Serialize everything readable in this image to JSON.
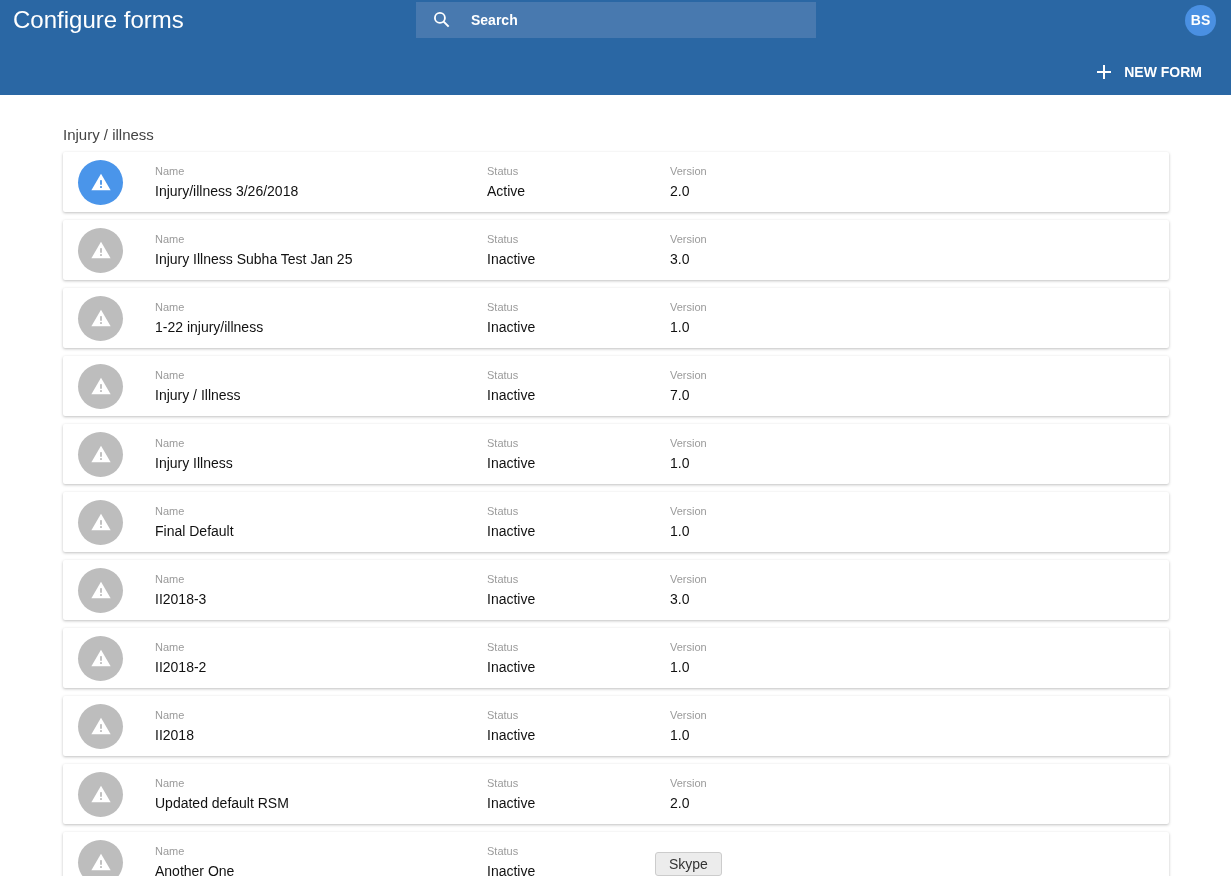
{
  "header": {
    "title": "Configure forms",
    "search": {
      "placeholder": "Search"
    },
    "avatar": "BS",
    "new_button": "NEW FORM"
  },
  "section": {
    "title": "Injury / illness"
  },
  "forms": [
    {
      "icon_active": true,
      "name_label": "Name",
      "name": "Injury/illness 3/26/2018",
      "status_label": "Status",
      "status": "Active",
      "version_label": "Version",
      "version": "2.0"
    },
    {
      "icon_active": false,
      "name_label": "Name",
      "name": "Injury Illness Subha Test Jan 25",
      "status_label": "Status",
      "status": "Inactive",
      "version_label": "Version",
      "version": "3.0"
    },
    {
      "icon_active": false,
      "name_label": "Name",
      "name": "1-22 injury/illness",
      "status_label": "Status",
      "status": "Inactive",
      "version_label": "Version",
      "version": "1.0"
    },
    {
      "icon_active": false,
      "name_label": "Name",
      "name": "Injury / Illness",
      "status_label": "Status",
      "status": "Inactive",
      "version_label": "Version",
      "version": "7.0"
    },
    {
      "icon_active": false,
      "name_label": "Name",
      "name": "Injury Illness",
      "status_label": "Status",
      "status": "Inactive",
      "version_label": "Version",
      "version": "1.0"
    },
    {
      "icon_active": false,
      "name_label": "Name",
      "name": "Final Default",
      "status_label": "Status",
      "status": "Inactive",
      "version_label": "Version",
      "version": "1.0"
    },
    {
      "icon_active": false,
      "name_label": "Name",
      "name": "II2018-3",
      "status_label": "Status",
      "status": "Inactive",
      "version_label": "Version",
      "version": "3.0"
    },
    {
      "icon_active": false,
      "name_label": "Name",
      "name": "II2018-2",
      "status_label": "Status",
      "status": "Inactive",
      "version_label": "Version",
      "version": "1.0"
    },
    {
      "icon_active": false,
      "name_label": "Name",
      "name": "II2018",
      "status_label": "Status",
      "status": "Inactive",
      "version_label": "Version",
      "version": "1.0"
    },
    {
      "icon_active": false,
      "name_label": "Name",
      "name": "Updated default RSM",
      "status_label": "Status",
      "status": "Inactive",
      "version_label": "Version",
      "version": "2.0"
    },
    {
      "icon_active": false,
      "name_label": "Name",
      "name": "Another One",
      "status_label": "Status",
      "status": "Inactive"
    }
  ],
  "tooltip": "Skype"
}
